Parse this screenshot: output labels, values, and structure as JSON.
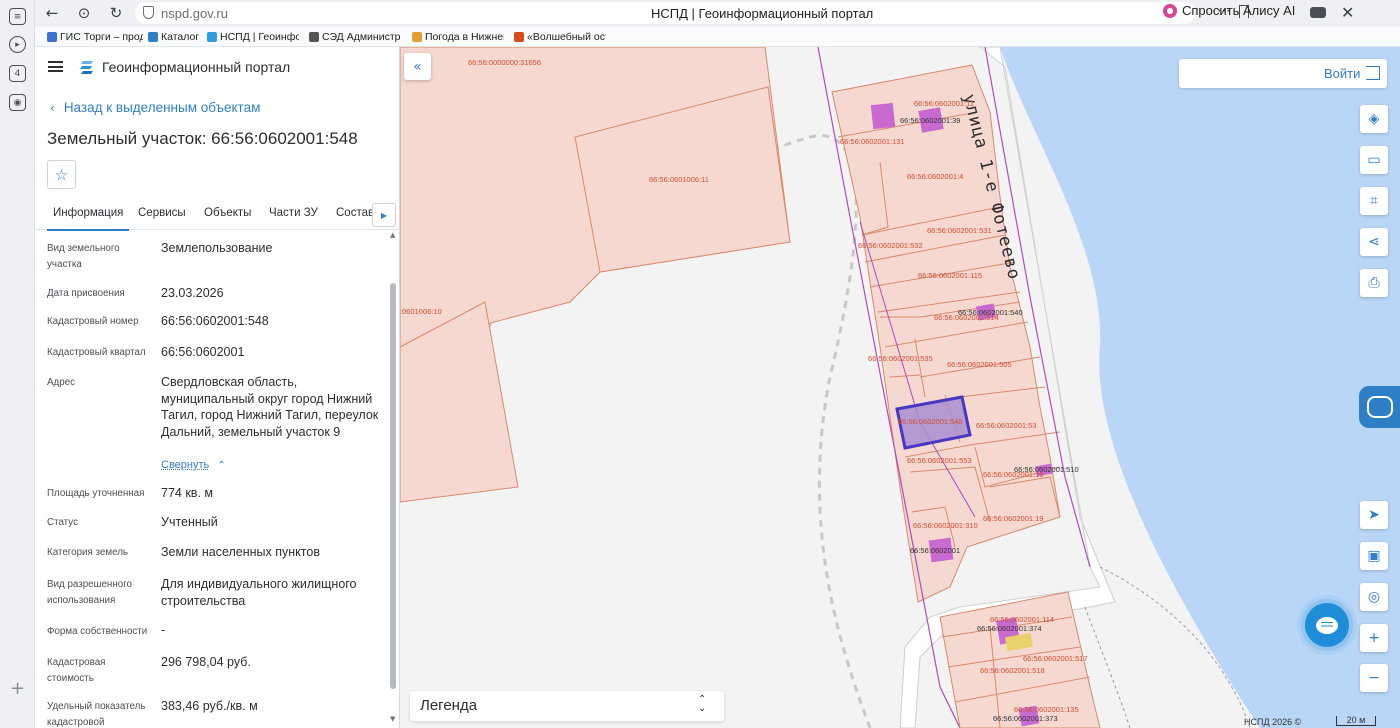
{
  "browser": {
    "url": "nspd.gov.ru",
    "tab_title": "НСПД | Геоинформационный портал",
    "alice_label": "Спросить Алису AI",
    "rail_badge": "4",
    "bookmarks": [
      {
        "label": "ГИС Торги – прод",
        "color": "#3b6fd4"
      },
      {
        "label": "Каталог",
        "color": "#2f7fc7"
      },
      {
        "label": "НСПД | Геоинфор",
        "color": "#2f9ee0"
      },
      {
        "label": "СЭД Администрат",
        "color": "#555555"
      },
      {
        "label": "Погода в Нижнем",
        "color": "#e0a030"
      },
      {
        "label": "«Волшебный остр",
        "color": "#d84a20"
      }
    ]
  },
  "panel": {
    "portal_title": "Геоинформационный портал",
    "back_label": "Назад к выделенным объектам",
    "object_title": "Земельный участок: 66:56:0602001:548",
    "tabs": [
      {
        "label": "Информация"
      },
      {
        "label": "Сервисы"
      },
      {
        "label": "Объекты"
      },
      {
        "label": "Части ЗУ"
      },
      {
        "label": "Состав"
      }
    ],
    "collapse_label": "Свернуть",
    "attributes": [
      {
        "label": "Вид земельного участка",
        "value": "Землепользование"
      },
      {
        "label": "Дата присвоения",
        "value": "23.03.2026"
      },
      {
        "label": "Кадастровый номер",
        "value": "66:56:0602001:548"
      },
      {
        "label": "Кадастровый квартал",
        "value": "66:56:0602001"
      },
      {
        "label": "Адрес",
        "value": "Свердловская область, муниципальный округ город Нижний Тагил, город Нижний Тагил, переулок Дальний, земельный участок 9"
      },
      {
        "label": "Площадь уточненная",
        "value": "774 кв. м"
      },
      {
        "label": "Статус",
        "value": "Учтенный"
      },
      {
        "label": "Категория земель",
        "value": "Земли населенных пунктов"
      },
      {
        "label": "Вид разрешенного использования",
        "value": "Для индивидуального жилищного строительства"
      },
      {
        "label": "Форма собственности",
        "value": "-"
      },
      {
        "label": "Кадастровая стоимость",
        "value": "296 798,04 руб."
      },
      {
        "label": "Удельный показатель кадастровой",
        "value": "383,46 руб./кв. м"
      }
    ]
  },
  "map": {
    "street_name": "улица 1-е Фотеево",
    "login_label": "Войти",
    "legend_label": "Легенда",
    "copyright": "НСПД 2026 ©",
    "scale_label": "20 м",
    "colors": {
      "parcel_fill": "#f5d8d0",
      "parcel_stroke": "#d98a6c",
      "selected": "#5a4fcf",
      "water": "#b9d6f7",
      "building": "#c96ad0"
    },
    "labels": [
      "66:56:0000000:31656",
      "66:56:0601006:11",
      ":0601006:10",
      "66:56:0602001:11",
      "66:56:0602001:39",
      "66:56:0602001:131",
      "66:56:0602001:4",
      "66:56:0602001:531",
      "66:56:0602001:532",
      "66:56:0602001:115",
      "66:56:0602001:540",
      "66:56:0602001:514",
      "66:56:0602001:535",
      "66:56:0602001:505",
      "66:56:0602001:548",
      "66:56:0602001:53",
      "66:56:0602001:553",
      "66:56:0602001:510",
      "66:56:0602001:16",
      "66:56:0602001:310",
      "66:56:0602001:19",
      "66:56:0602001",
      "66:56:0602001:114",
      "66:56:0602001:374",
      "66:56:0602001:517",
      "66:56:0602001:518",
      "66:56:0602001:135",
      "66:56:0602001:373"
    ]
  }
}
